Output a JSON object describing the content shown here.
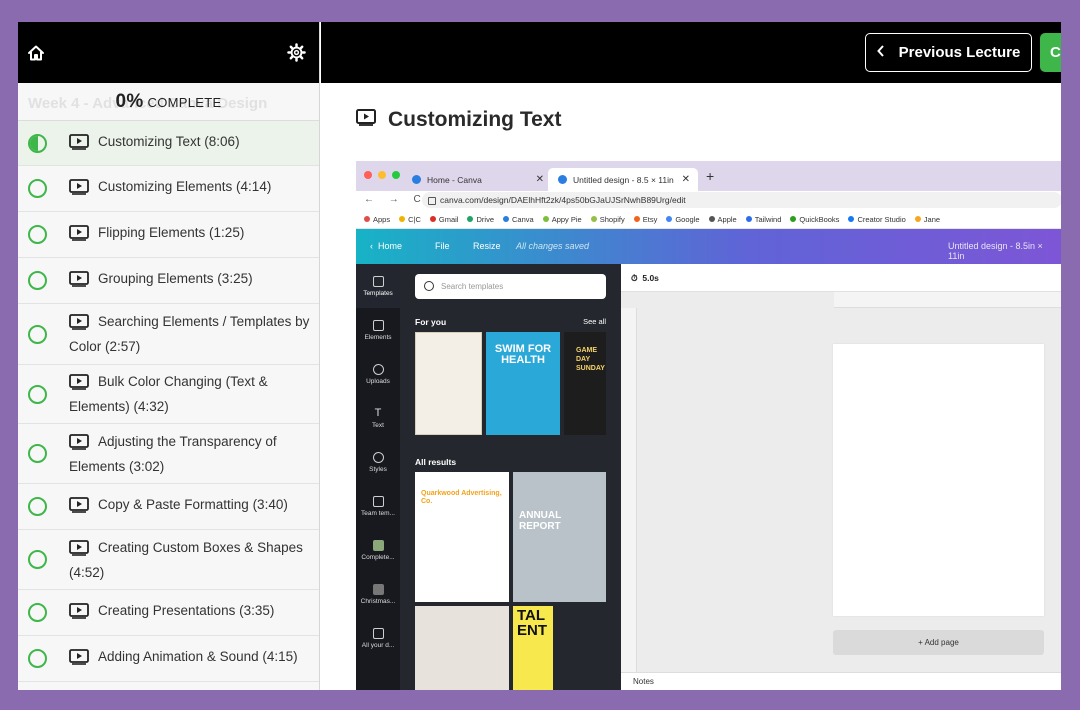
{
  "sidebar": {
    "progress_percent": "0%",
    "progress_label": "COMPLETE",
    "section_title": "Week 4 - Advanced Canva Design",
    "lectures": [
      {
        "title": "Customizing Text (8:06)",
        "status": "in-progress"
      },
      {
        "title": "Customizing Elements (4:14)",
        "status": "incomplete"
      },
      {
        "title": "Flipping Elements (1:25)",
        "status": "incomplete"
      },
      {
        "title": "Grouping Elements (3:25)",
        "status": "incomplete"
      },
      {
        "title": "Searching Elements / Templates by Color (2:57)",
        "status": "incomplete"
      },
      {
        "title": "Bulk Color Changing (Text & Elements) (4:32)",
        "status": "incomplete"
      },
      {
        "title": "Adjusting the Transparency of Elements (3:02)",
        "status": "incomplete"
      },
      {
        "title": "Copy & Paste Formatting (3:40)",
        "status": "incomplete"
      },
      {
        "title": "Creating Custom Boxes & Shapes (4:52)",
        "status": "incomplete"
      },
      {
        "title": "Creating Presentations (3:35)",
        "status": "incomplete"
      },
      {
        "title": "Adding Animation & Sound (4:15)",
        "status": "incomplete"
      }
    ]
  },
  "topbar": {
    "previous_label": "Previous Lecture",
    "next_label": "C"
  },
  "lecture": {
    "title": "Customizing Text"
  },
  "screenshot": {
    "tabs": [
      "Home - Canva",
      "Untitled design - 8.5 × 11in"
    ],
    "url": "canva.com/design/DAElhHft2zk/4ps50bGJaUJSrNwhB89Urg/edit",
    "bookmarks": [
      "Apps",
      "C|C",
      "Gmail",
      "Drive",
      "Canva",
      "Appy Pie",
      "Shopify",
      "Etsy",
      "Google",
      "Apple",
      "Tailwind",
      "QuickBooks",
      "Creator Studio",
      "Jane"
    ],
    "canva_nav": {
      "home": "Home",
      "file": "File",
      "resize": "Resize",
      "saved": "All changes saved",
      "doc_title": "Untitled design - 8.5in × 11in"
    },
    "rail": [
      "Templates",
      "Elements",
      "Uploads",
      "Text",
      "Styles",
      "Team tem...",
      "Complete...",
      "Christmas...",
      "All your d..."
    ],
    "search_placeholder": "Search templates",
    "for_you": "For you",
    "see_all": "See all",
    "all_results": "All results",
    "thumb_texts": {
      "swim": "SWIM FOR HEALTH",
      "game": "GAME DAY SUNDAY",
      "quarkwood": "Quarkwood Advertising, Co.",
      "annual": "ANNUAL REPORT",
      "talent": "TALENT"
    },
    "timer": "5.0s",
    "add_page": "+ Add page",
    "notes": "Notes"
  },
  "colors": {
    "accent_green": "#3fb64a",
    "frame_purple": "#8a6bb0"
  }
}
